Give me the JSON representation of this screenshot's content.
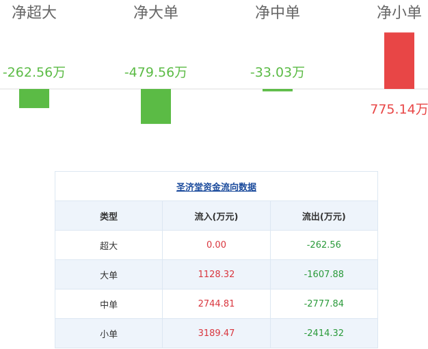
{
  "chart_data": {
    "type": "bar",
    "categories": [
      "净超大",
      "净大单",
      "净中单",
      "净小单"
    ],
    "values": [
      -262.56,
      -479.56,
      -33.03,
      775.14
    ],
    "value_labels": [
      "-262.56万",
      "-479.56万",
      "-33.03万",
      "775.14万"
    ],
    "unit": "万",
    "colors": {
      "positive": "#e84646",
      "negative": "#5bbb45",
      "axis": "#dddddd",
      "category_text": "#666666"
    }
  },
  "table": {
    "title": "圣济堂资金流向数据",
    "headers": [
      "类型",
      "流入(万元)",
      "流出(万元)"
    ],
    "rows": [
      {
        "type": "超大",
        "inflow": "0.00",
        "outflow": "-262.56"
      },
      {
        "type": "大单",
        "inflow": "1128.32",
        "outflow": "-1607.88"
      },
      {
        "type": "中单",
        "inflow": "2744.81",
        "outflow": "-2777.84"
      },
      {
        "type": "小单",
        "inflow": "3189.47",
        "outflow": "-2414.32"
      }
    ]
  }
}
